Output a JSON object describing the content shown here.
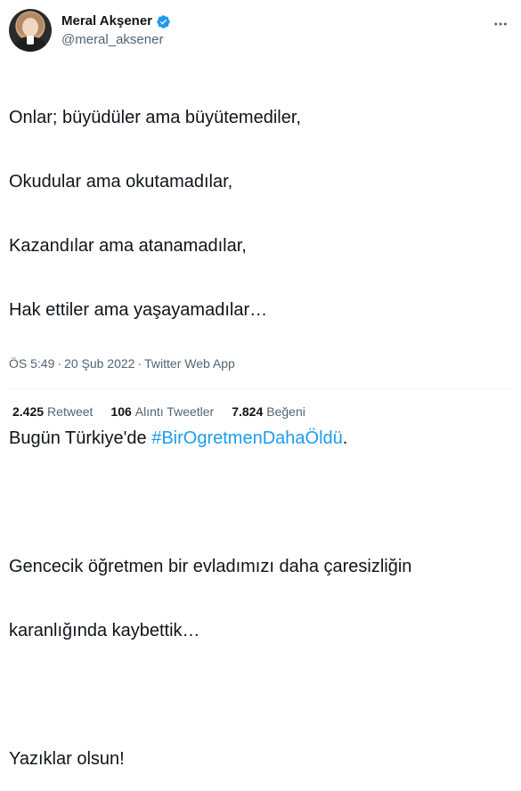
{
  "author": {
    "display_name": "Meral Akşener",
    "username": "@meral_aksener",
    "verified_badge_icon": "verified-badge-icon",
    "avatar_icon": "avatar"
  },
  "tweet": {
    "line1": "Onlar; büyüdüler ama büyütemediler,",
    "line2": "Okudular ama okutamadılar,",
    "line3": "Kazandılar ama atanamadılar,",
    "line4": "Hak ettiler ama yaşayamadılar…",
    "line5_prefix": "Bugün Türkiye'de ",
    "hashtag": "#BirOgretmenDahaÖldü",
    "line5_suffix": ".",
    "line6": "Gencecik öğretmen bir evladımızı daha çaresizliğin",
    "line7": "karanlığında kaybettik…",
    "line8": "Yazıklar olsun!"
  },
  "meta": {
    "time": "ÖS 5:49",
    "date": "20 Şub 2022",
    "source": "Twitter Web App",
    "separator": "·"
  },
  "stats": {
    "retweets_count": "2.425",
    "retweets_label": "Retweet",
    "quotes_count": "106",
    "quotes_label": "Alıntı Tweetler",
    "likes_count": "7.824",
    "likes_label": "Beğeni"
  },
  "colors": {
    "accent": "#1d9bf0",
    "text": "#0f1419",
    "secondary": "#536471",
    "divider": "#eff3f4"
  }
}
